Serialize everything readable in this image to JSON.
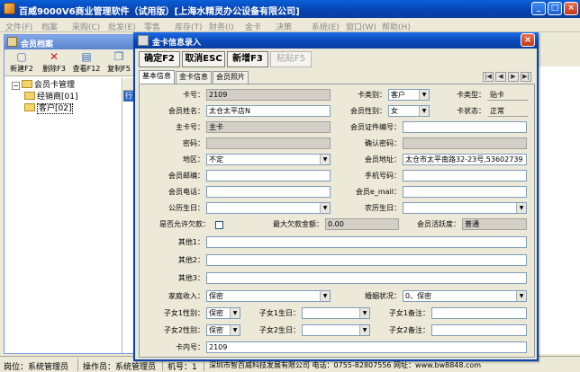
{
  "app": {
    "title": "百威9000V6商业管理软件（试用版）[上海水精灵办公设备有限公司]",
    "window_buttons": {
      "minimize": "_",
      "maximize": "□",
      "close": "×"
    }
  },
  "menu": [
    "文件(F)",
    "档案",
    "采购(C)",
    "批发(E)",
    "零售",
    "库存(T)",
    "财务(I)",
    "金卡",
    "决策",
    "系统(E)",
    "窗口(W)",
    "帮助(H)"
  ],
  "child": {
    "title": "会员档案",
    "toolbar": [
      {
        "label": "新建F2",
        "icon": "new-doc-icon",
        "glyph": "▢"
      },
      {
        "label": "删除F3",
        "icon": "delete-icon",
        "glyph": "✕"
      },
      {
        "label": "查看F12",
        "icon": "view-icon",
        "glyph": "▤"
      },
      {
        "label": "复制F5",
        "icon": "copy-icon",
        "glyph": "❐"
      }
    ],
    "tree": {
      "root": "会员卡管理",
      "children": [
        "经销商[01]",
        "客户[02]"
      ]
    },
    "grid_header_fragment": "行"
  },
  "dialog": {
    "title": "金卡信息录入",
    "close": "×",
    "buttons": {
      "confirm": "确定F2",
      "cancel": "取消ESC",
      "add": "新增F3",
      "paste": "粘贴F5"
    },
    "tabs": [
      "基本信息",
      "金卡信息",
      "会员照片"
    ],
    "nav": [
      "|◀",
      "◀",
      "▶",
      "▶|"
    ],
    "fields": {
      "card_no": {
        "label": "卡号：",
        "value": "2109"
      },
      "card_category": {
        "label": "卡类别：",
        "value": "客户"
      },
      "card_type": {
        "label": "卡类型：",
        "value": "贴卡"
      },
      "member_name": {
        "label": "会员姓名：",
        "value": "太仓太平店N"
      },
      "gender": {
        "label": "会员性别：",
        "value": "女"
      },
      "card_status": {
        "label": "卡状态：",
        "value": "正常"
      },
      "main_card": {
        "label": "主卡号：",
        "value": "主卡"
      },
      "id_no": {
        "label": "会员证件编号：",
        "value": ""
      },
      "password": {
        "label": "密码：",
        "value": ""
      },
      "confirm_password": {
        "label": "确认密码：",
        "value": ""
      },
      "region": {
        "label": "地区：",
        "value": "不定"
      },
      "address": {
        "label": "会员地址：",
        "value": "太仓市太平南路32-23号,53602739"
      },
      "zip": {
        "label": "会员邮编：",
        "value": ""
      },
      "mobile": {
        "label": "手机号码：",
        "value": ""
      },
      "phone": {
        "label": "会员电话：",
        "value": ""
      },
      "email": {
        "label": "会员e_mail：",
        "value": ""
      },
      "birthday": {
        "label": "公历生日：",
        "value": ""
      },
      "lunar_birthday": {
        "label": "农历生日：",
        "value": ""
      },
      "allow_debt": {
        "label": "是否允许欠款：",
        "checked": false
      },
      "max_debt": {
        "label": "最大欠款金额：",
        "value": "0.00"
      },
      "activity": {
        "label": "会员活跃度：",
        "value": "普通"
      },
      "other1": {
        "label": "其他1：",
        "value": ""
      },
      "other2": {
        "label": "其他2：",
        "value": ""
      },
      "other3": {
        "label": "其他3：",
        "value": ""
      },
      "income": {
        "label": "家庭收入：",
        "value": "保密"
      },
      "marital": {
        "label": "婚姻状况：",
        "value": "0、保密"
      },
      "child1_gender": {
        "label": "子女1性别：",
        "value": "保密"
      },
      "child1_birthday": {
        "label": "子女1生日：",
        "value": ""
      },
      "child1_note": {
        "label": "子女1备注：",
        "value": ""
      },
      "child2_gender": {
        "label": "子女2性别：",
        "value": "保密"
      },
      "child2_birthday": {
        "label": "子女2生日：",
        "value": ""
      },
      "child2_note": {
        "label": "子女2备注：",
        "value": ""
      },
      "inner_card_no": {
        "label": "卡内号：",
        "value": "2109"
      }
    }
  },
  "status": {
    "position": "岗位：系统管理员",
    "operator": "操作员：系统管理员",
    "machine": "机号：1",
    "company": "深圳市智百威科技发展有限公司 电话：0755-82807556 网址：www.bw8848.com"
  }
}
